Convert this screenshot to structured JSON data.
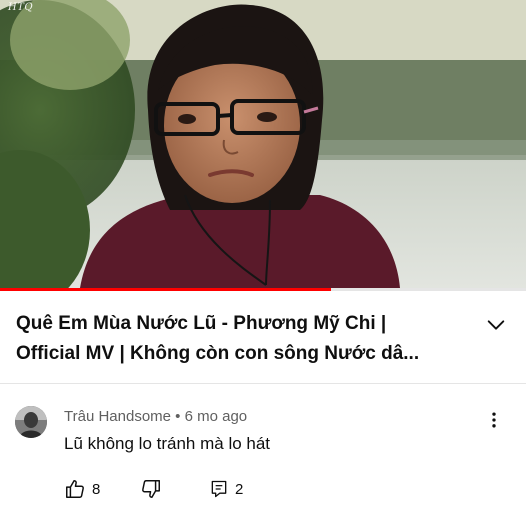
{
  "watermark": "HTQ",
  "player": {
    "progress_fraction": 0.63,
    "progress_color": "#ff0000"
  },
  "video": {
    "title_line1": "Quê Em Mùa Nước Lũ - Phương Mỹ Chi |",
    "title_line2": "Official MV | Không còn con sông Nước dâ..."
  },
  "comment": {
    "author": "Trâu Handsome",
    "separator": "•",
    "age": "6 mo ago",
    "text": "Lũ không lo tránh mà lo hát",
    "likes": "8",
    "replies": "2"
  },
  "icons": {
    "expand": "chevron-down-icon",
    "more": "more-vertical-icon",
    "like": "thumbs-up-icon",
    "dislike": "thumbs-down-icon",
    "reply": "comment-icon"
  }
}
